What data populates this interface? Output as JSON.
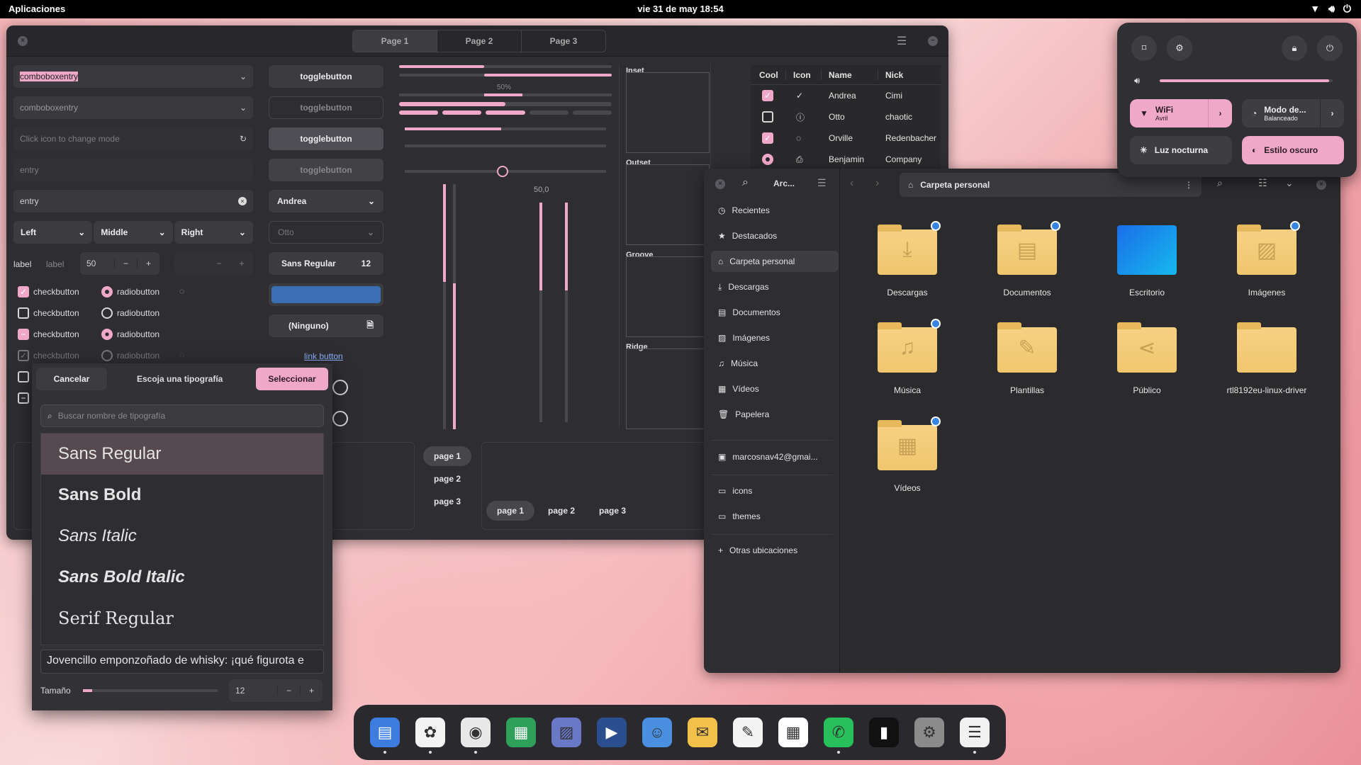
{
  "topbar": {
    "apps": "Aplicaciones",
    "clock": "vie 31 de may  18:54"
  },
  "gtk": {
    "tabs": [
      "Page 1",
      "Page 2",
      "Page 3"
    ],
    "combo1": "comboboxentry",
    "combo2": "comboboxentry",
    "entry_mode_placeholder": "Click icon to change mode",
    "entry1": "entry",
    "entry2": "entry",
    "seg": [
      "Left",
      "Middle",
      "Right"
    ],
    "label1": "label",
    "label2": "label",
    "spin_value": "50",
    "checks": [
      "checkbutton",
      "checkbutton",
      "checkbutton",
      "checkbutton"
    ],
    "radios": [
      "radiobutton",
      "radiobutton",
      "radiobutton",
      "radiobutton"
    ],
    "toggles": [
      "togglebutton",
      "togglebutton",
      "togglebutton",
      "togglebutton"
    ],
    "combo_andrea": "Andrea",
    "combo_otto": "Otto",
    "font_btn": "Sans Regular",
    "font_btn_size": "12",
    "accent_color": "#3c6eb4",
    "file_btn": "(Ninguno)",
    "link": "link button",
    "progress_label": "50%",
    "scale_value": "50,0",
    "frames": [
      "Inset",
      "Outset",
      "Groove",
      "Ridge"
    ],
    "tree": {
      "headers": [
        "Cool",
        "Icon",
        "Name",
        "Nick"
      ],
      "rows": [
        {
          "cool": true,
          "icon": "check-circle-icon",
          "name": "Andrea",
          "nick": "Cimi"
        },
        {
          "cool": false,
          "icon": "warning-circle-icon",
          "name": "Otto",
          "nick": "chaotic"
        },
        {
          "cool": true,
          "icon": "spinner-icon",
          "name": "Orville",
          "nick": "Redenbacher"
        },
        {
          "cool": "radio",
          "icon": "printer-icon",
          "name": "Benjamin",
          "nick": "Company"
        }
      ]
    },
    "notebook_v": [
      "page 1",
      "page 2",
      "page 3"
    ],
    "notebook_h": [
      "page 1",
      "page 2",
      "page 3"
    ]
  },
  "fontchooser": {
    "cancel": "Cancelar",
    "title": "Escoja una tipografía",
    "select": "Seleccionar",
    "search_placeholder": "Buscar nombre de tipografía",
    "fonts": [
      "Sans Regular",
      "Sans Bold",
      "Sans Italic",
      "Sans Bold Italic",
      "Serif Regular"
    ],
    "preview": "Jovencillo emponzoñado de whisky: ¡qué figurota e",
    "size_label": "Tamaño",
    "size_value": "12",
    "size_level": 0.07
  },
  "files": {
    "title_short": "Arc...",
    "path": "Carpeta personal",
    "sidebar": [
      "Recientes",
      "Destacados",
      "Carpeta personal",
      "Descargas",
      "Documentos",
      "Imágenes",
      "Música",
      "Vídeos",
      "Papelera"
    ],
    "account": "marcosnav42@gmai...",
    "bookmarks": [
      "icons",
      "themes"
    ],
    "other": "Otras ubicaciones",
    "folders": [
      {
        "name": "Descargas",
        "glyph": "⤓",
        "badge": true
      },
      {
        "name": "Documentos",
        "glyph": "▤",
        "badge": true
      },
      {
        "name": "Escritorio",
        "glyph": "",
        "badge": false,
        "desktop": true
      },
      {
        "name": "Imágenes",
        "glyph": "▨",
        "badge": true
      },
      {
        "name": "Música",
        "glyph": "♫",
        "badge": true
      },
      {
        "name": "Plantillas",
        "glyph": "✎",
        "badge": false
      },
      {
        "name": "Público",
        "glyph": "⋖",
        "badge": false
      },
      {
        "name": "rtl8192eu-linux-driver",
        "glyph": "",
        "badge": false
      },
      {
        "name": "Vídeos",
        "glyph": "▦",
        "badge": true
      }
    ]
  },
  "quicksettings": {
    "volume": 0.98,
    "wifi": "WiFi",
    "wifi_sub": "Avril",
    "power": "Modo de...",
    "power_sub": "Balanceado",
    "night": "Luz nocturna",
    "dark": "Estilo oscuro"
  },
  "dock": {
    "apps": [
      {
        "icon": "files-icon",
        "color": "#3d7de0",
        "running": true
      },
      {
        "icon": "software-store-icon",
        "color": "#f3f3f3",
        "running": true
      },
      {
        "icon": "chrome-icon",
        "color": "#e8e8e8",
        "running": true
      },
      {
        "icon": "spreadsheet-icon",
        "color": "#2ea05a",
        "running": false
      },
      {
        "icon": "image-viewer-icon",
        "color": "#6a78c8",
        "running": false
      },
      {
        "icon": "video-editor-icon",
        "color": "#2b4e8e",
        "running": false
      },
      {
        "icon": "contacts-icon",
        "color": "#4a8fe0",
        "running": false
      },
      {
        "icon": "mail-icon",
        "color": "#f3c04a",
        "running": false
      },
      {
        "icon": "text-editor-icon",
        "color": "#f4f4f4",
        "running": false
      },
      {
        "icon": "calendar-icon",
        "color": "#ffffff",
        "running": false
      },
      {
        "icon": "whatsapp-icon",
        "color": "#27c05a",
        "running": true
      },
      {
        "icon": "terminal-icon",
        "color": "#111111",
        "running": false
      },
      {
        "icon": "settings-icon",
        "color": "#8b8b8b",
        "running": false
      },
      {
        "icon": "widget-factory-icon",
        "color": "#f1f1f1",
        "running": true
      }
    ]
  }
}
